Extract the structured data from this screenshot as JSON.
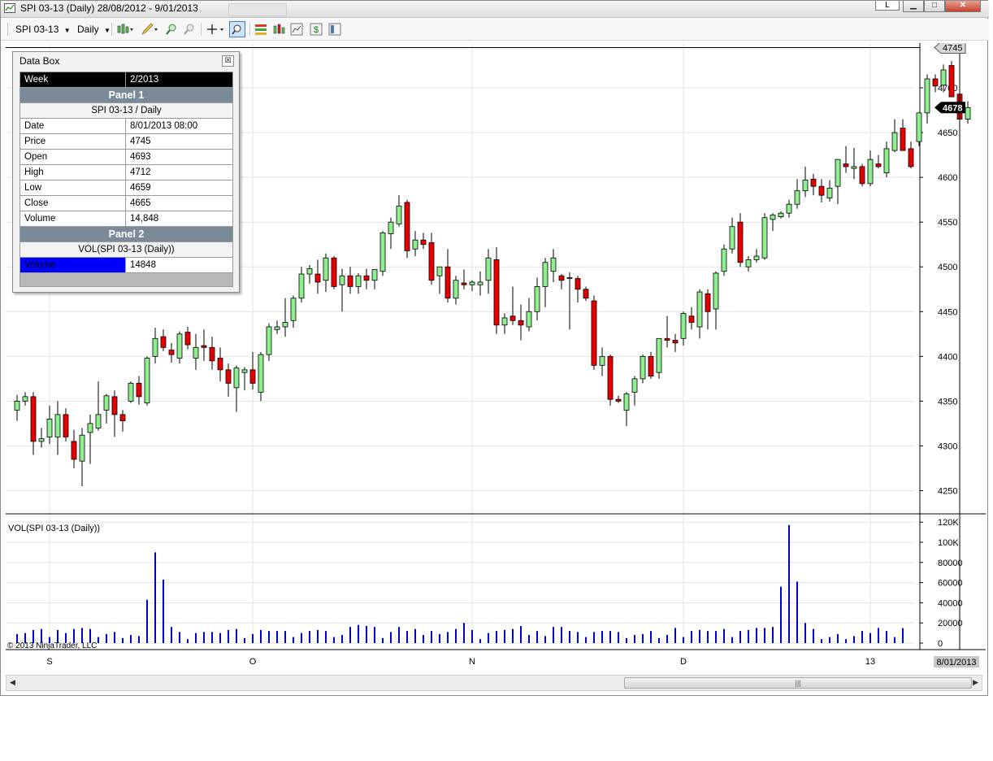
{
  "window": {
    "title": "SPI 03-13 (Daily)  28/08/2012 - 9/01/2013",
    "btn_min": "▁",
    "btn_max": "□",
    "btn_close": "✕",
    "btn_link": "L"
  },
  "toolbar": {
    "instrument": "SPI 03-13",
    "interval": "Daily"
  },
  "databox": {
    "title": "Data Box",
    "close": "☒",
    "week_label": "Week",
    "week_value": "2/2013",
    "panel1": "Panel 1",
    "panel1_sub": "SPI 03-13 / Daily",
    "rows": [
      {
        "label": "Date",
        "value": "8/01/2013 08:00"
      },
      {
        "label": "Price",
        "value": "4745"
      },
      {
        "label": "Open",
        "value": "4693"
      },
      {
        "label": "High",
        "value": "4712"
      },
      {
        "label": "Low",
        "value": "4659"
      },
      {
        "label": "Close",
        "value": "4665"
      },
      {
        "label": "Volume",
        "value": "14,848"
      }
    ],
    "panel2": "Panel 2",
    "panel2_sub": "VOL(SPI 03-13 (Daily))",
    "vol_label": "Volume",
    "vol_value": "14848"
  },
  "chart_data": {
    "type": "candlestick",
    "instrument": "SPI 03-13",
    "interval": "Daily",
    "price_ticks": [
      4250,
      4300,
      4350,
      4400,
      4450,
      4500,
      4550,
      4600,
      4650,
      4700
    ],
    "price_range": [
      4225,
      4750
    ],
    "crosshair_price": 4745,
    "crosshair_label": "4745",
    "last_price_label": "4678",
    "volume_title": "VOL(SPI 03-13 (Daily))",
    "volume_ticks": [
      "120K",
      "100K",
      "80000",
      "60000",
      "40000",
      "20000",
      "0"
    ],
    "volume_range": [
      0,
      125000
    ],
    "last_volume_label": "14848",
    "x_labels": [
      {
        "label": "S",
        "index": 4
      },
      {
        "label": "O",
        "index": 29
      },
      {
        "label": "N",
        "index": 56
      },
      {
        "label": "D",
        "index": 82
      },
      {
        "label": "13",
        "index": 105
      }
    ],
    "crosshair_date_label": "8/01/2013",
    "copyright": "© 2013 NinjaTrader, LLC",
    "candles": [
      [
        4340,
        4357,
        4328,
        4350
      ],
      [
        4350,
        4360,
        4345,
        4355
      ],
      [
        4355,
        4360,
        4290,
        4305
      ],
      [
        4305,
        4320,
        4298,
        4308
      ],
      [
        4310,
        4345,
        4302,
        4330
      ],
      [
        4310,
        4350,
        4290,
        4335
      ],
      [
        4335,
        4342,
        4305,
        4310
      ],
      [
        4305,
        4318,
        4275,
        4285
      ],
      [
        4283,
        4320,
        4255,
        4312
      ],
      [
        4315,
        4335,
        4280,
        4325
      ],
      [
        4320,
        4372,
        4317,
        4335
      ],
      [
        4340,
        4358,
        4325,
        4356
      ],
      [
        4355,
        4362,
        4310,
        4335
      ],
      [
        4335,
        4340,
        4316,
        4328
      ],
      [
        4350,
        4372,
        4348,
        4370
      ],
      [
        4370,
        4378,
        4346,
        4355
      ],
      [
        4348,
        4400,
        4345,
        4398
      ],
      [
        4400,
        4432,
        4392,
        4420
      ],
      [
        4422,
        4430,
        4406,
        4410
      ],
      [
        4407,
        4415,
        4393,
        4402
      ],
      [
        4398,
        4428,
        4392,
        4425
      ],
      [
        4427,
        4433,
        4408,
        4413
      ],
      [
        4398,
        4425,
        4385,
        4410
      ],
      [
        4412,
        4430,
        4395,
        4410
      ],
      [
        4410,
        4422,
        4385,
        4395
      ],
      [
        4398,
        4410,
        4372,
        4385
      ],
      [
        4385,
        4392,
        4355,
        4370
      ],
      [
        4365,
        4390,
        4338,
        4387
      ],
      [
        4382,
        4388,
        4362,
        4385
      ],
      [
        4385,
        4405,
        4363,
        4370
      ],
      [
        4360,
        4405,
        4350,
        4402
      ],
      [
        4402,
        4437,
        4395,
        4433
      ],
      [
        4430,
        4440,
        4425,
        4433
      ],
      [
        4433,
        4465,
        4422,
        4438
      ],
      [
        4440,
        4468,
        4432,
        4465
      ],
      [
        4465,
        4500,
        4460,
        4492
      ],
      [
        4492,
        4502,
        4481,
        4498
      ],
      [
        4492,
        4508,
        4470,
        4483
      ],
      [
        4485,
        4515,
        4472,
        4510
      ],
      [
        4510,
        4512,
        4475,
        4478
      ],
      [
        4480,
        4498,
        4450,
        4490
      ],
      [
        4490,
        4500,
        4470,
        4478
      ],
      [
        4478,
        4493,
        4470,
        4490
      ],
      [
        4490,
        4498,
        4475,
        4485
      ],
      [
        4485,
        4496,
        4475,
        4497
      ],
      [
        4495,
        4540,
        4490,
        4538
      ],
      [
        4537,
        4555,
        4520,
        4550
      ],
      [
        4548,
        4580,
        4545,
        4568
      ],
      [
        4572,
        4575,
        4510,
        4518
      ],
      [
        4520,
        4540,
        4512,
        4530
      ],
      [
        4530,
        4538,
        4520,
        4525
      ],
      [
        4527,
        4538,
        4480,
        4485
      ],
      [
        4490,
        4500,
        4470,
        4500
      ],
      [
        4500,
        4520,
        4460,
        4465
      ],
      [
        4465,
        4490,
        4458,
        4485
      ],
      [
        4482,
        4497,
        4475,
        4480
      ],
      [
        4480,
        4485,
        4473,
        4483
      ],
      [
        4480,
        4495,
        4468,
        4483
      ],
      [
        4485,
        4520,
        4470,
        4510
      ],
      [
        4508,
        4522,
        4425,
        4435
      ],
      [
        4435,
        4448,
        4425,
        4443
      ],
      [
        4445,
        4478,
        4435,
        4440
      ],
      [
        4440,
        4458,
        4418,
        4435
      ],
      [
        4433,
        4465,
        4428,
        4450
      ],
      [
        4450,
        4488,
        4440,
        4478
      ],
      [
        4478,
        4510,
        4455,
        4505
      ],
      [
        4495,
        4520,
        4483,
        4510
      ],
      [
        4490,
        4492,
        4475,
        4485
      ],
      [
        4488,
        4494,
        4430,
        4488
      ],
      [
        4487,
        4490,
        4460,
        4475
      ],
      [
        4475,
        4478,
        4462,
        4465
      ],
      [
        4462,
        4468,
        4385,
        4390
      ],
      [
        4390,
        4410,
        4378,
        4400
      ],
      [
        4400,
        4402,
        4345,
        4352
      ],
      [
        4352,
        4356,
        4348,
        4350
      ],
      [
        4340,
        4360,
        4322,
        4358
      ],
      [
        4360,
        4378,
        4345,
        4375
      ],
      [
        4375,
        4402,
        4370,
        4400
      ],
      [
        4400,
        4405,
        4375,
        4378
      ],
      [
        4382,
        4420,
        4375,
        4420
      ],
      [
        4420,
        4445,
        4410,
        4418
      ],
      [
        4418,
        4425,
        4405,
        4415
      ],
      [
        4420,
        4450,
        4412,
        4448
      ],
      [
        4445,
        4455,
        4430,
        4438
      ],
      [
        4433,
        4475,
        4420,
        4472
      ],
      [
        4470,
        4475,
        4430,
        4450
      ],
      [
        4453,
        4495,
        4430,
        4493
      ],
      [
        4495,
        4525,
        4490,
        4520
      ],
      [
        4520,
        4555,
        4515,
        4545
      ],
      [
        4550,
        4560,
        4500,
        4505
      ],
      [
        4500,
        4512,
        4495,
        4508
      ],
      [
        4508,
        4520,
        4505,
        4512
      ],
      [
        4510,
        4560,
        4508,
        4555
      ],
      [
        4553,
        4560,
        4540,
        4558
      ],
      [
        4556,
        4562,
        4554,
        4560
      ],
      [
        4560,
        4575,
        4555,
        4570
      ],
      [
        4570,
        4598,
        4565,
        4585
      ],
      [
        4585,
        4612,
        4578,
        4597
      ],
      [
        4598,
        4604,
        4580,
        4590
      ],
      [
        4590,
        4598,
        4572,
        4580
      ],
      [
        4577,
        4597,
        4573,
        4588
      ],
      [
        4590,
        4614,
        4570,
        4620
      ],
      [
        4615,
        4635,
        4605,
        4612
      ],
      [
        4610,
        4633,
        4598,
        4612
      ],
      [
        4612,
        4615,
        4590,
        4593
      ],
      [
        4593,
        4630,
        4590,
        4620
      ],
      [
        4615,
        4625,
        4610,
        4612
      ],
      [
        4605,
        4640,
        4600,
        4632
      ],
      [
        4630,
        4665,
        4628,
        4650
      ],
      [
        4655,
        4665,
        4630,
        4630
      ],
      [
        4632,
        4640,
        4610,
        4612
      ],
      [
        4640,
        4672,
        4635,
        4672
      ],
      [
        4672,
        4715,
        4660,
        4710
      ],
      [
        4710,
        4715,
        4695,
        4702
      ],
      [
        4703,
        4726,
        4695,
        4720
      ],
      [
        4725,
        4730,
        4690,
        4690
      ],
      [
        4693,
        4712,
        4659,
        4665
      ],
      [
        4665,
        4685,
        4660,
        4678
      ]
    ],
    "volumes": [
      9000,
      10000,
      13000,
      14000,
      6000,
      13000,
      10000,
      14000,
      15000,
      14000,
      6000,
      9000,
      11000,
      5000,
      8000,
      7000,
      43000,
      90000,
      63000,
      16000,
      11000,
      4000,
      10000,
      11000,
      11000,
      10000,
      13000,
      14000,
      5000,
      9000,
      13000,
      12000,
      12000,
      12000,
      6000,
      10000,
      12000,
      13000,
      12000,
      6000,
      8000,
      16000,
      18000,
      17000,
      16000,
      5000,
      11000,
      16000,
      12000,
      14000,
      8000,
      12000,
      9000,
      11000,
      14000,
      20000,
      13000,
      4000,
      10000,
      12000,
      13000,
      14000,
      17000,
      8000,
      12000,
      7000,
      16000,
      16000,
      12000,
      11000,
      6000,
      11000,
      12000,
      12000,
      11000,
      5000,
      8000,
      9000,
      12000,
      5000,
      8000,
      15000,
      6000,
      12000,
      13000,
      12000,
      12000,
      14000,
      6000,
      12000,
      13000,
      15000,
      15000,
      16000,
      56000,
      117000,
      61000,
      20000,
      14000,
      4000,
      6000,
      9000,
      4000,
      7000,
      12000,
      10000,
      15000,
      12000,
      6000,
      14848
    ]
  }
}
